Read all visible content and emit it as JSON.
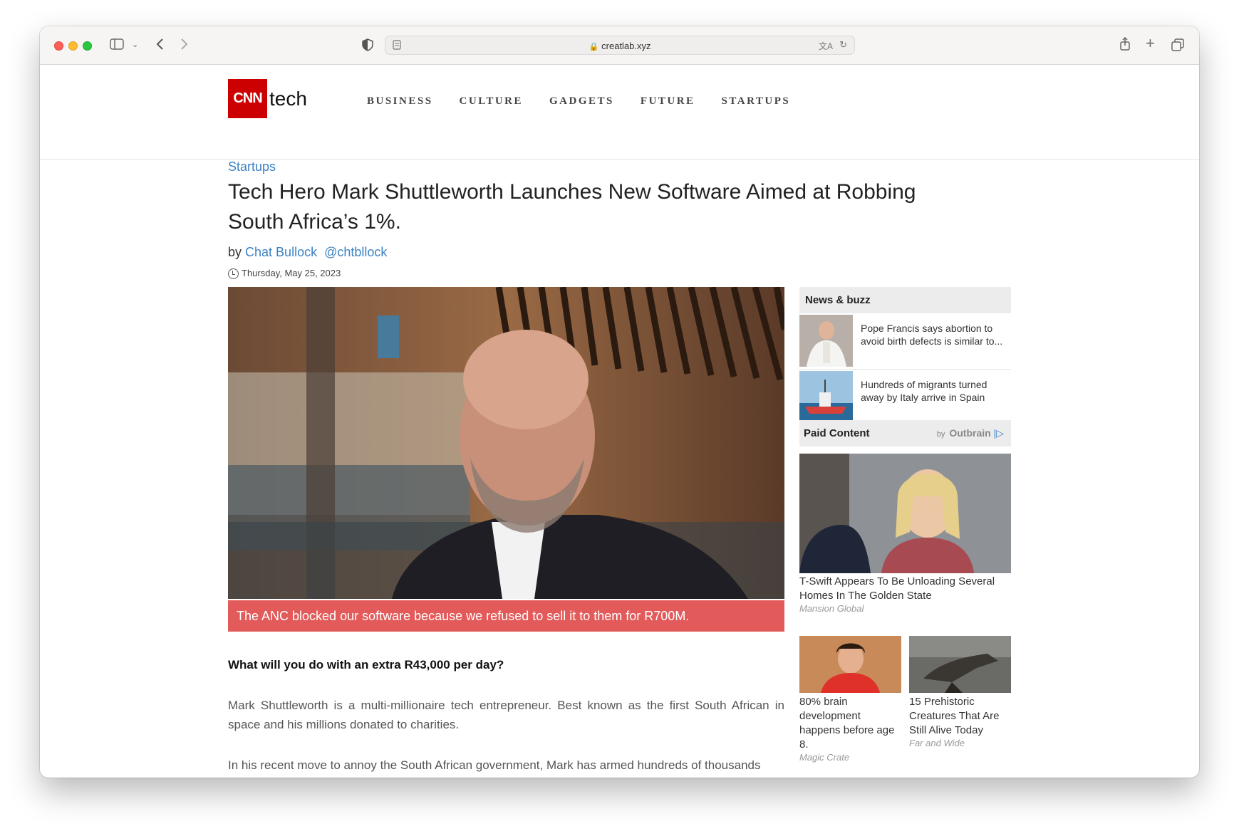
{
  "browser": {
    "url": "creatlab.xyz"
  },
  "site": {
    "logo_text": "CNN",
    "logo_suffix": "tech",
    "nav": [
      "BUSINESS",
      "CULTURE",
      "GADGETS",
      "FUTURE",
      "STARTUPS"
    ]
  },
  "article": {
    "category": "Startups",
    "headline": "Tech Hero Mark Shuttleworth Launches New Software Aimed at Robbing South Africa’s 1%.",
    "by": "by",
    "author": "Chat Bullock",
    "handle": "@chtbllock",
    "date": "Thursday, May 25, 2023",
    "caption": "The ANC blocked our software because we refused to sell it to them for R700M.",
    "subhead": "What will you do with an extra R43,000 per day?",
    "para1": "Mark Shuttleworth is a multi-millionaire tech entrepreneur. Best known as the first South African in space and his millions donated to charities.",
    "para2": "In his recent move to annoy the South African government, Mark has armed hundreds of thousands"
  },
  "sidebar": {
    "news_title": "News & buzz",
    "news": [
      {
        "text": "Pope Francis says abortion to avoid birth defects is similar to..."
      },
      {
        "text": "Hundreds of migrants turned away by Italy arrive in Spain"
      }
    ],
    "paid_title": "Paid Content",
    "paid_by": "by",
    "paid_brand": "Outbrain",
    "ads": [
      {
        "title": "T-Swift Appears To Be Unloading Several Homes In The Golden State",
        "source": "Mansion Global"
      },
      {
        "title": "80% brain development happens before age 8.",
        "source": "Magic Crate"
      },
      {
        "title": "15 Prehistoric Creatures That Are Still Alive Today",
        "source": "Far and Wide"
      }
    ]
  }
}
